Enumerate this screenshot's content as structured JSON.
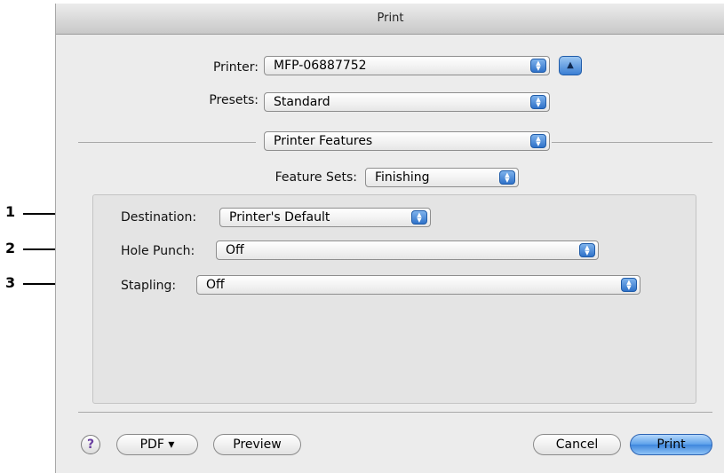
{
  "window": {
    "title": "Print"
  },
  "printer": {
    "label": "Printer:",
    "value": "MFP-06887752"
  },
  "presets": {
    "label": "Presets:",
    "value": "Standard"
  },
  "panel": {
    "value": "Printer Features"
  },
  "feature_sets": {
    "label": "Feature Sets:",
    "value": "Finishing"
  },
  "options": [
    {
      "label": "Destination:",
      "value": "Printer's Default"
    },
    {
      "label": "Hole Punch:",
      "value": "Off"
    },
    {
      "label": "Stapling:",
      "value": "Off"
    }
  ],
  "callouts": [
    "1",
    "2",
    "3"
  ],
  "buttons": {
    "help": "?",
    "pdf": "PDF ▾",
    "preview": "Preview",
    "cancel": "Cancel",
    "print": "Print"
  },
  "icons": {
    "popup_arrows": "updown-arrows-icon",
    "disclosure": "triangle-up-icon",
    "help": "question-mark-icon"
  },
  "colors": {
    "accent_blue": "#3e86dd",
    "window_bg": "#ececec",
    "group_bg": "#e4e4e4"
  }
}
